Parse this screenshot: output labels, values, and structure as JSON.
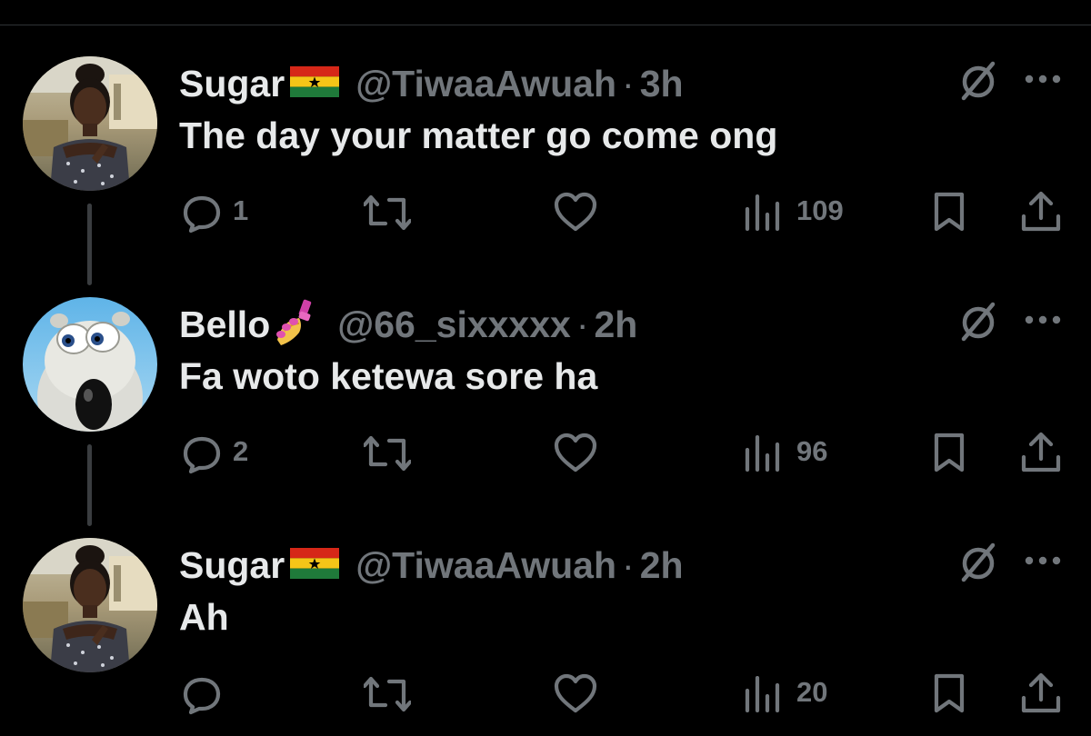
{
  "tweets": [
    {
      "name": "Sugar",
      "handle": "@TiwaaAwuah",
      "dot": "·",
      "time": "3h",
      "text": "The day your matter go come ong",
      "reply_count": "1",
      "retweet_count": "",
      "like_count": "",
      "views": "109",
      "name_emoji": "ghana-flag-icon",
      "avatar": "woman-portrait-avatar"
    },
    {
      "name": "Bello",
      "handle": "@66_sixxxxx",
      "dot": "·",
      "time": "2h",
      "text": "Fa woto ketewa sore ha",
      "reply_count": "2",
      "retweet_count": "",
      "like_count": "",
      "views": "96",
      "name_emoji": "nail-polish-icon",
      "avatar": "cartoon-bear-avatar"
    },
    {
      "name": "Sugar",
      "handle": "@TiwaaAwuah",
      "dot": "·",
      "time": "2h",
      "text": "Ah",
      "reply_count": "",
      "retweet_count": "",
      "like_count": "",
      "views": "20",
      "name_emoji": "ghana-flag-icon",
      "avatar": "woman-portrait-avatar"
    }
  ],
  "colors": {
    "background": "#000000",
    "text": "#e7e9ea",
    "muted": "#71767b",
    "thread_line": "#3a3d40"
  }
}
